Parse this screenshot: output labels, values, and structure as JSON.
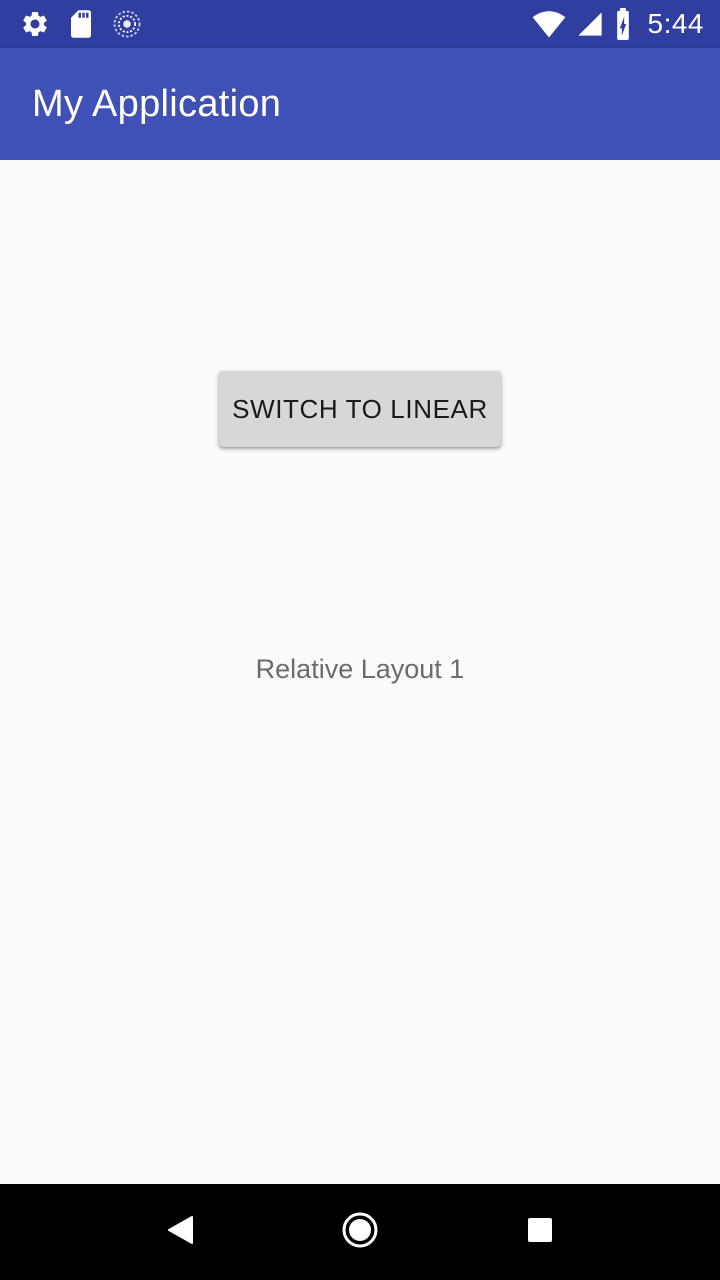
{
  "status_bar": {
    "time": "5:44",
    "icons_left": [
      "settings-gear-icon",
      "sd-card-icon",
      "sync-loading-icon"
    ],
    "icons_right": [
      "wifi-icon",
      "cellular-signal-icon",
      "battery-charging-icon"
    ]
  },
  "app_bar": {
    "title": "My Application",
    "color": "#3f51b5",
    "status_color": "#303f9f"
  },
  "main": {
    "switch_button_label": "SWITCH TO LINEAR",
    "layout_label": "Relative Layout 1"
  },
  "nav_bar": {
    "buttons": [
      "back-icon",
      "home-icon",
      "recents-icon"
    ]
  }
}
